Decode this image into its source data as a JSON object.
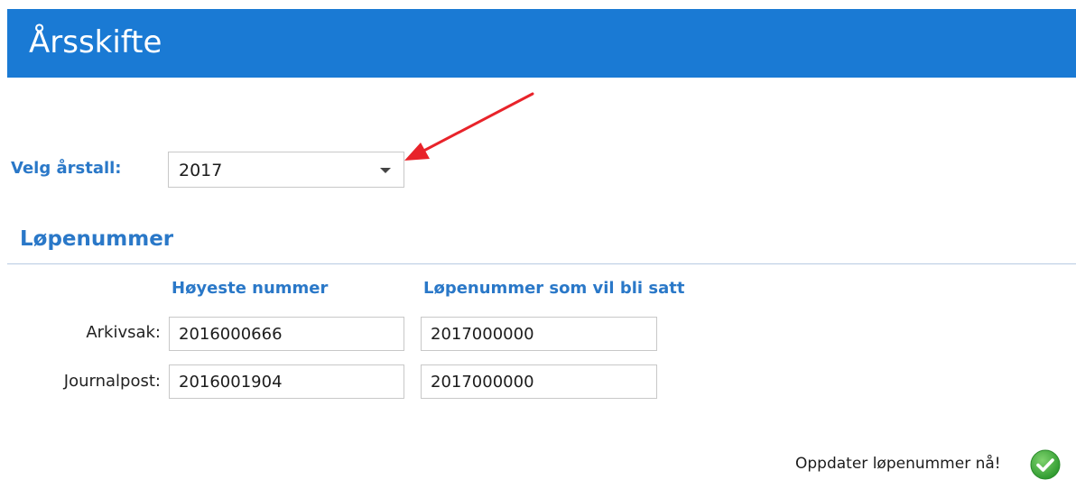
{
  "header": {
    "title": "Årsskifte",
    "background_color": "#1a7ad4"
  },
  "year_selector": {
    "label": "Velg årstall:",
    "selected_value": "2017",
    "icon": "chevron-down-icon"
  },
  "annotation": {
    "icon": "red-arrow-icon",
    "color": "#e8232a"
  },
  "lopenummer": {
    "title": "Løpenummer",
    "columns": {
      "highest": "Høyeste nummer",
      "next": "Løpenummer som vil bli satt"
    },
    "rows": [
      {
        "label": "Arkivsak:",
        "highest_value": "2016000666",
        "next_value": "2017000000"
      },
      {
        "label": "Journalpost:",
        "highest_value": "2016001904",
        "next_value": "2017000000"
      }
    ]
  },
  "actions": {
    "update_label": "Oppdater løpenummer nå!",
    "update_icon": "check-circle-icon",
    "accent_color": "#3aa63a"
  },
  "colors": {
    "label_blue": "#2a78c8",
    "divider": "#b7cbe3"
  }
}
